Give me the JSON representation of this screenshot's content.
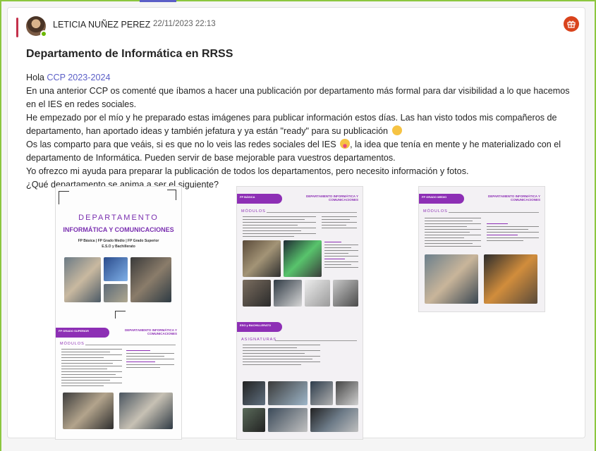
{
  "message": {
    "author": "LETICIA NUÑEZ PEREZ",
    "timestamp": "22/11/2023 22:13",
    "subject": "Departamento de Informática en RRSS",
    "greeting": "Hola",
    "mention": "CCP 2023-2024",
    "p1": "En una anterior CCP os comenté que íbamos a hacer una publicación por departamento más formal para dar visibilidad a lo que hacemos en el IES en redes sociales.",
    "p2": "He empezado por el mío y he preparado estas imágenes para publicar información estos días. Las han visto todos mis compañeros de departamento, han aportado ideas y también jefatura y ya están \"ready\" para su publicación",
    "p3a": "Os las comparto para que veáis, si es que no lo veis las redes sociales del IES",
    "p3b": ", la idea que tenía en mente y he materializado con el departamento de Informática. Pueden servir de base mejorable para vuestros departamentos.",
    "p4": "Yo ofrezco mi ayuda para preparar la publicación de todos los departamentos, pero necesito información y fotos.",
    "p5": "¿Qué departamento se anima a ser el siguiente?",
    "reaction_icon": "gift-icon"
  },
  "attachments": [
    {
      "title": "DEPARTAMENTO",
      "subtitle": "INFORMÁTICA Y COMUNICACIONES",
      "line1": "FP Básica | FP Grado Medio | FP Grado Superior",
      "line2": "E.S.O y Bachillerato",
      "banner": "FP GRADO SUPERIOR",
      "header_right": "DEPARTAMENTO INFORMÁTICA Y COMUNICACIONES",
      "section": "MÓDULOS"
    },
    {
      "banner": "FP BÁSICA",
      "header_right": "DEPARTAMENTO INFORMÁTICA Y COMUNICACIONES",
      "section": "MÓDULOS",
      "banner2": "ESO y BACHILLERATO",
      "section2": "ASIGNATURAS"
    },
    {
      "banner": "FP GRADO MEDIO",
      "header_right": "DEPARTAMENTO INFORMÁTICA Y COMUNICACIONES",
      "section": "MÓDULOS"
    }
  ],
  "colors": {
    "accent_purple": "#8d2fb5",
    "mention_blue": "#5b5fc7",
    "presence_green": "#6bb700",
    "reaction_orange": "#d9431c"
  }
}
